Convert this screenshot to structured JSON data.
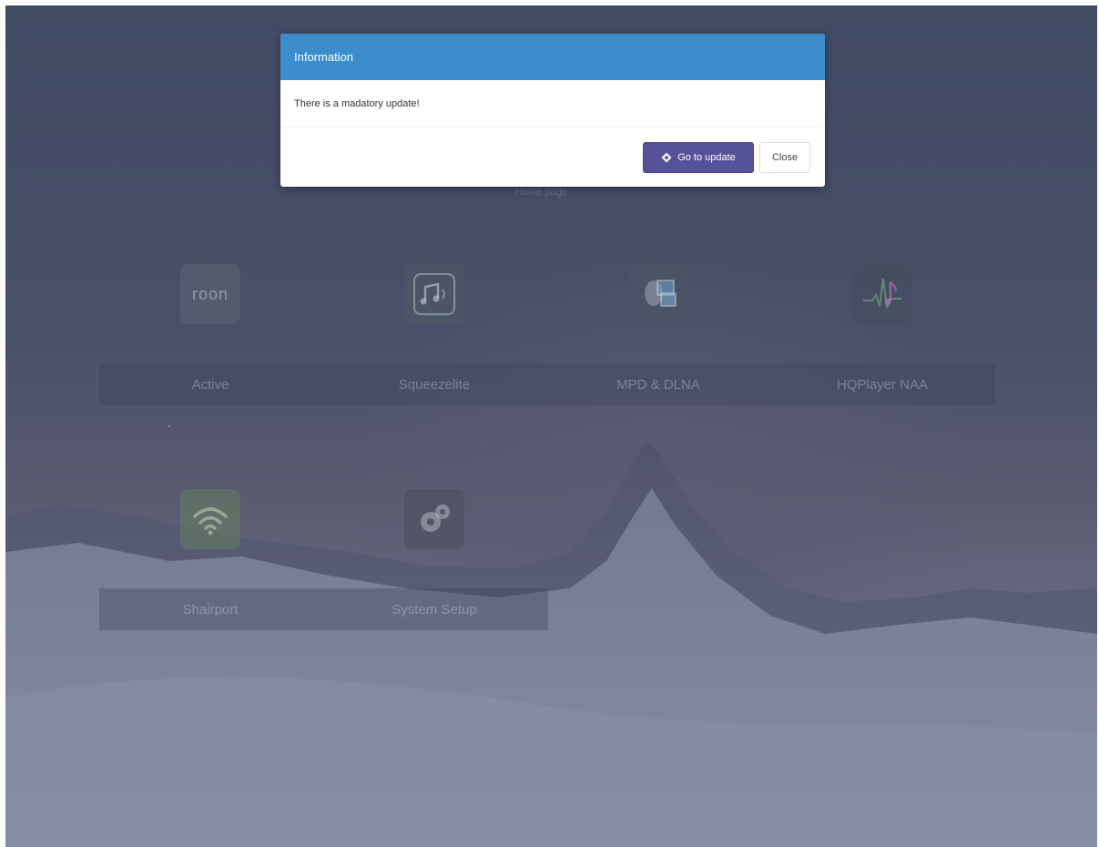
{
  "background": {
    "hidden_caption": "Home page"
  },
  "apps": [
    {
      "label": "Active",
      "icon": "roon-icon",
      "logo_text": "roon"
    },
    {
      "label": "Squeezelite",
      "icon": "music-note-speaker-icon"
    },
    {
      "label": "MPD & DLNA",
      "icon": "speaker-screen-icon"
    },
    {
      "label": "HQPlayer NAA",
      "icon": "waveform-note-icon"
    },
    {
      "label": "Shairport",
      "icon": "wifi-icon"
    },
    {
      "label": "System Setup",
      "icon": "gears-icon"
    }
  ],
  "modal": {
    "title": "Information",
    "message": "There is a madatory update!",
    "update_button": "Go to update",
    "update_icon": "diamond-icon",
    "close_button": "Close"
  },
  "colors": {
    "modal_header": "#3c8dcb",
    "update_button": "#555299",
    "overlay": "#46526e"
  }
}
